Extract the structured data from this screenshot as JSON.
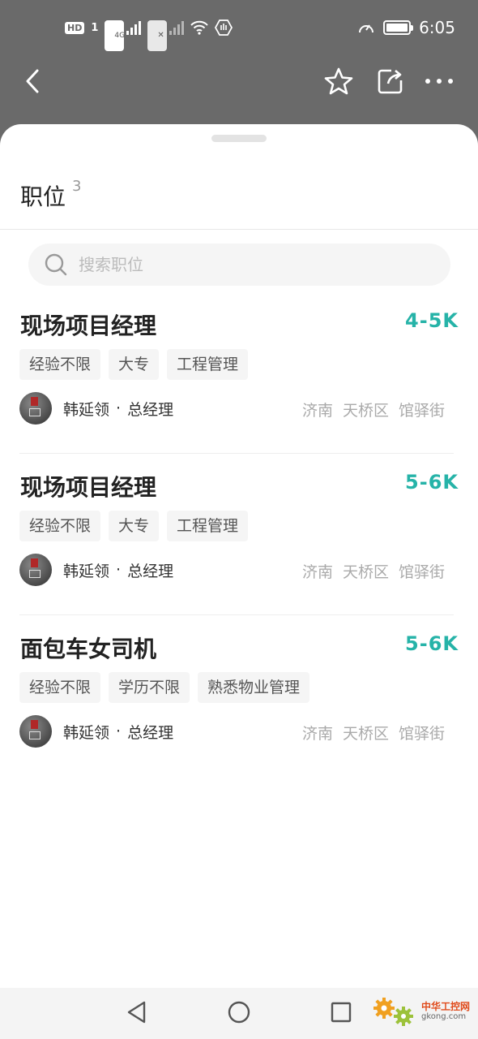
{
  "status_bar": {
    "hd": "HD",
    "sim": "1",
    "network": "4G",
    "time": "6:05"
  },
  "app_bar": {
    "icons": [
      "back-icon",
      "star-icon",
      "share-icon",
      "more-icon"
    ]
  },
  "header": {
    "title": "职位",
    "count": "3"
  },
  "search": {
    "placeholder": "搜索职位"
  },
  "jobs": [
    {
      "title": "现场项目经理",
      "salary": "4-5K",
      "tags": [
        "经验不限",
        "大专",
        "工程管理"
      ],
      "recruiter": {
        "name": "韩延领",
        "dot": "·",
        "role": "总经理"
      },
      "location": [
        "济南",
        "天桥区",
        "馆驿街"
      ]
    },
    {
      "title": "现场项目经理",
      "salary": "5-6K",
      "tags": [
        "经验不限",
        "大专",
        "工程管理"
      ],
      "recruiter": {
        "name": "韩延领",
        "dot": "·",
        "role": "总经理"
      },
      "location": [
        "济南",
        "天桥区",
        "馆驿街"
      ]
    },
    {
      "title": "面包车女司机",
      "salary": "5-6K",
      "tags": [
        "经验不限",
        "学历不限",
        "熟悉物业管理"
      ],
      "recruiter": {
        "name": "韩延领",
        "dot": "·",
        "role": "总经理"
      },
      "location": [
        "济南",
        "天桥区",
        "馆驿街"
      ]
    }
  ],
  "watermark": {
    "cn": "中华工控网",
    "en": "gkong.com"
  },
  "colors": {
    "accent_salary": "#26b3a8",
    "top_bar": "#6a6a6a",
    "watermark": "#e04b1c"
  }
}
